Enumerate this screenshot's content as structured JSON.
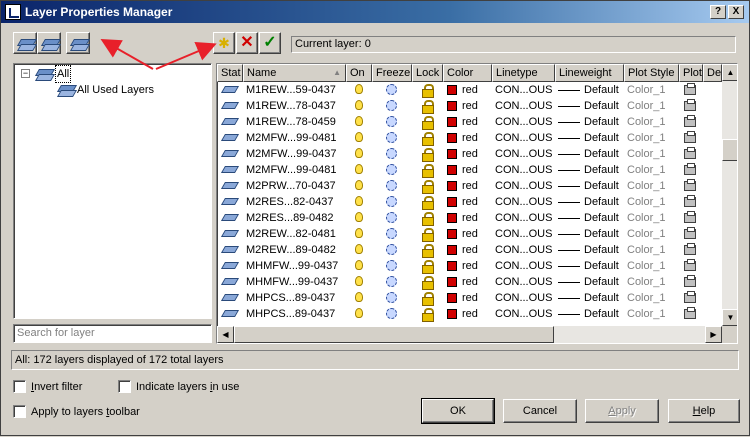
{
  "window": {
    "title": "Layer Properties Manager",
    "help_label": "?",
    "close_label": "X"
  },
  "current_layer": "Current layer: 0",
  "tree": {
    "root_label": "All",
    "root_toggle": "−",
    "child_label": "All Used Layers"
  },
  "search": {
    "placeholder": "Search for layer"
  },
  "columns": [
    "Stat",
    "Name",
    "On",
    "Freeze",
    "Lock",
    "Color",
    "Linetype",
    "Lineweight",
    "Plot Style",
    "Plot",
    "De"
  ],
  "layers": [
    {
      "name": "M1REW...59-0437",
      "color": "red",
      "linetype": "CON...OUS",
      "lineweight": "Default",
      "plot_style": "Color_1"
    },
    {
      "name": "M1REW...78-0437",
      "color": "red",
      "linetype": "CON...OUS",
      "lineweight": "Default",
      "plot_style": "Color_1"
    },
    {
      "name": "M1REW...78-0459",
      "color": "red",
      "linetype": "CON...OUS",
      "lineweight": "Default",
      "plot_style": "Color_1"
    },
    {
      "name": "M2MFW...99-0481",
      "color": "red",
      "linetype": "CON...OUS",
      "lineweight": "Default",
      "plot_style": "Color_1"
    },
    {
      "name": "M2MFW...99-0437",
      "color": "red",
      "linetype": "CON...OUS",
      "lineweight": "Default",
      "plot_style": "Color_1"
    },
    {
      "name": "M2MFW...99-0481",
      "color": "red",
      "linetype": "CON...OUS",
      "lineweight": "Default",
      "plot_style": "Color_1"
    },
    {
      "name": "M2PRW...70-0437",
      "color": "red",
      "linetype": "CON...OUS",
      "lineweight": "Default",
      "plot_style": "Color_1"
    },
    {
      "name": "M2RES...82-0437",
      "color": "red",
      "linetype": "CON...OUS",
      "lineweight": "Default",
      "plot_style": "Color_1"
    },
    {
      "name": "M2RES...89-0482",
      "color": "red",
      "linetype": "CON...OUS",
      "lineweight": "Default",
      "plot_style": "Color_1"
    },
    {
      "name": "M2REW...82-0481",
      "color": "red",
      "linetype": "CON...OUS",
      "lineweight": "Default",
      "plot_style": "Color_1"
    },
    {
      "name": "M2REW...89-0482",
      "color": "red",
      "linetype": "CON...OUS",
      "lineweight": "Default",
      "plot_style": "Color_1"
    },
    {
      "name": "MHMFW...99-0437",
      "color": "red",
      "linetype": "CON...OUS",
      "lineweight": "Default",
      "plot_style": "Color_1"
    },
    {
      "name": "MHMFW...99-0437",
      "color": "red",
      "linetype": "CON...OUS",
      "lineweight": "Default",
      "plot_style": "Color_1"
    },
    {
      "name": "MHPCS...89-0437",
      "color": "red",
      "linetype": "CON...OUS",
      "lineweight": "Default",
      "plot_style": "Color_1"
    },
    {
      "name": "MHPCS...89-0437",
      "color": "red",
      "linetype": "CON...OUS",
      "lineweight": "Default",
      "plot_style": "Color_1"
    }
  ],
  "status": "All: 172 layers displayed of 172 total layers",
  "options": {
    "invert_filter_pre": "",
    "invert_filter_u": "I",
    "invert_filter_post": "nvert filter",
    "indicate_pre": "Indicate layers ",
    "indicate_u": "i",
    "indicate_post": "n use",
    "apply_toolbar_pre": "Apply to layers ",
    "apply_toolbar_u": "t",
    "apply_toolbar_post": "oolbar"
  },
  "buttons": {
    "ok": "OK",
    "cancel": "Cancel",
    "apply_u": "A",
    "apply_post": "pply",
    "help_u": "H",
    "help_post": "elp"
  },
  "colors": {
    "titlebar": "#0a246a",
    "layer_color": "#d00000",
    "arrow": "#e8202a",
    "chrome": "#d4d0c8"
  }
}
